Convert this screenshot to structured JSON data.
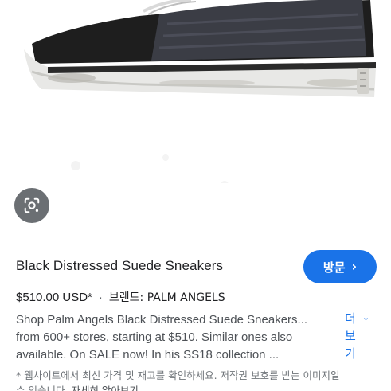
{
  "product": {
    "title": "Black Distressed Suede Sneakers",
    "price": "$510.00 USD*",
    "separator": "·",
    "brand": "브랜드: PALM ANGELS",
    "description_lines": [
      "Shop Palm Angels Black Distressed Suede Sneakers...",
      "from 600+ stores, starting at $510. Similar ones also",
      "available. On SALE now! In his SS18 collection ..."
    ]
  },
  "actions": {
    "visit_label": "방문",
    "visit_chevron": "›",
    "more_label_line1": "더",
    "more_label_line2": "보",
    "more_label_line3": "기",
    "more_chevron": "⌄"
  },
  "disclaimer": {
    "line1": "* 웹사이트에서 최신 가격 및 재고를 확인하세요. 저작권 보호를 받는 이미지일",
    "line2_prefix": "수 있습니다.",
    "line2_link": "자세히 알아보기"
  },
  "icons": {
    "lens": "google-lens-icon",
    "visit_chevron": "chevron-right-icon",
    "more_chevron": "chevron-down-icon"
  },
  "colors": {
    "accent": "#1a73e8",
    "text_primary": "#202124",
    "text_secondary": "#4d5156",
    "text_muted": "#70757a"
  }
}
